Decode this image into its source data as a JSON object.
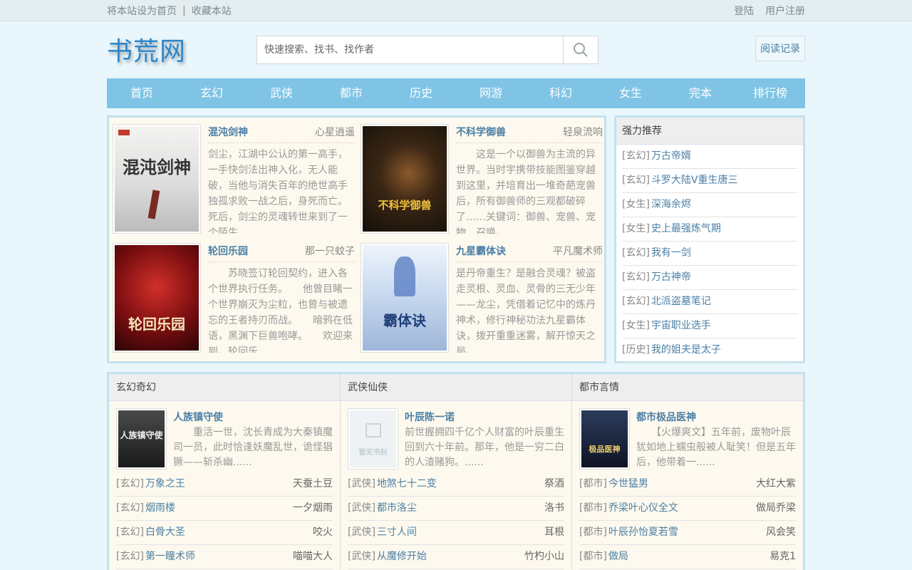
{
  "topbar": {
    "set_home": "将本站设为首页",
    "separator": "|",
    "bookmark": "收藏本站",
    "login": "登陆",
    "register": "用户注册"
  },
  "header": {
    "logo": "书荒网",
    "search_placeholder": "快速搜索、找书、找作者",
    "reading_history": "阅读记录"
  },
  "nav": [
    "首页",
    "玄幻",
    "武侠",
    "都市",
    "历史",
    "网游",
    "科幻",
    "女生",
    "完本",
    "排行榜"
  ],
  "featured": [
    {
      "title": "混沌剑神",
      "author": "心星逍遥",
      "cover_text": "混沌剑神",
      "desc": "剑尘，江湖中公认的第一高手，一手快剑法出神入化，无人能破，当他与消失百年的绝世高手独孤求败一战之后，身死而亡。死后，剑尘的灵魂转世来到了一个陌生......"
    },
    {
      "title": "不科学御兽",
      "author": "轻泉流响",
      "cover_text": "不科学御兽",
      "desc": "　　这是一个以御兽为主流的异世界。当时宇携带技能图鉴穿越到这里，并培育出一堆奇葩宠兽后，所有御兽师的三观都破碎了……关键词：御兽、宠兽、宠物、召唤。......"
    },
    {
      "title": "轮回乐园",
      "author": "那一只蚊子",
      "cover_text": "轮回乐园",
      "desc": "　　苏晓签订轮回契约，进入各个世界执行任务。　　他曾目睹一个世界崩灭为尘粒，也曾与被遗忘的王者持刃而战。　　暗鸦在低语，黑渊下巨兽咆哮。　　欢迎来到，轮回乐......"
    },
    {
      "title": "九星霸体诀",
      "author": "平凡魔术师",
      "cover_text": "霸体诀",
      "desc": "是丹帝重生？是融合灵魂？被盗走灵根、灵血、灵骨的三无少年——龙尘，凭借着记忆中的炼丹神术，修行神秘功法九星霸体诀，拨开重重迷雾，解开惊天之局。 ......"
    }
  ],
  "recommend": {
    "heading": "强力推荐",
    "items": [
      {
        "cat": "[玄幻]",
        "title": "万古帝婿"
      },
      {
        "cat": "[玄幻]",
        "title": "斗罗大陆V重生唐三"
      },
      {
        "cat": "[女生]",
        "title": "深海余烬"
      },
      {
        "cat": "[女生]",
        "title": "史上最强炼气期"
      },
      {
        "cat": "[玄幻]",
        "title": "我有一剑"
      },
      {
        "cat": "[玄幻]",
        "title": "万古神帝"
      },
      {
        "cat": "[玄幻]",
        "title": "北派盗墓笔记"
      },
      {
        "cat": "[女生]",
        "title": "宇宙职业选手"
      },
      {
        "cat": "[历史]",
        "title": "我的姐夫是太子"
      }
    ]
  },
  "sections": [
    {
      "heading": "玄幻奇幻",
      "top": {
        "title": "人族镇守使",
        "cover_text": "人族镇守使",
        "desc": "　　重活一世，沈长青成为大秦镇魔司一员，此时恰逢妖魔乱世，诡怪猖獗——斩杀幽......"
      },
      "items": [
        {
          "cat": "[玄幻]",
          "title": "万象之王",
          "author": "天蚕土豆"
        },
        {
          "cat": "[玄幻]",
          "title": "烟雨楼",
          "author": "一夕烟雨"
        },
        {
          "cat": "[玄幻]",
          "title": "白骨大圣",
          "author": "咬火"
        },
        {
          "cat": "[玄幻]",
          "title": "第一瞳术师",
          "author": "喵喵大人"
        }
      ]
    },
    {
      "heading": "武侠仙侠",
      "top": {
        "title": "叶辰陈一诺",
        "cover_text": "暂无书封",
        "desc": "前世握拥四千亿个人财富的叶辰重生回到六十年前。那年，他是一穷二白的人渣赌狗。......"
      },
      "items": [
        {
          "cat": "[武侠]",
          "title": "地煞七十二变",
          "author": "祭酒"
        },
        {
          "cat": "[武侠]",
          "title": "都市洛尘",
          "author": "洛书"
        },
        {
          "cat": "[武侠]",
          "title": "三寸人间",
          "author": "耳根"
        },
        {
          "cat": "[武侠]",
          "title": "从魔修开始",
          "author": "竹杓小山"
        }
      ]
    },
    {
      "heading": "都市言情",
      "top": {
        "title": "都市极品医神",
        "cover_text": "极品医神",
        "desc": "　　【火爆爽文】五年前，废物叶辰犹如地上蠕虫般被人耻笑！但是五年后，他带着一......"
      },
      "items": [
        {
          "cat": "[都市]",
          "title": "今世猛男",
          "author": "大红大紫"
        },
        {
          "cat": "[都市]",
          "title": "乔梁叶心仪全文",
          "author": "做局乔梁"
        },
        {
          "cat": "[都市]",
          "title": "叶辰孙怡夏若雪",
          "author": "风会笑"
        },
        {
          "cat": "[都市]",
          "title": "做局",
          "author": "易克1"
        }
      ]
    }
  ]
}
